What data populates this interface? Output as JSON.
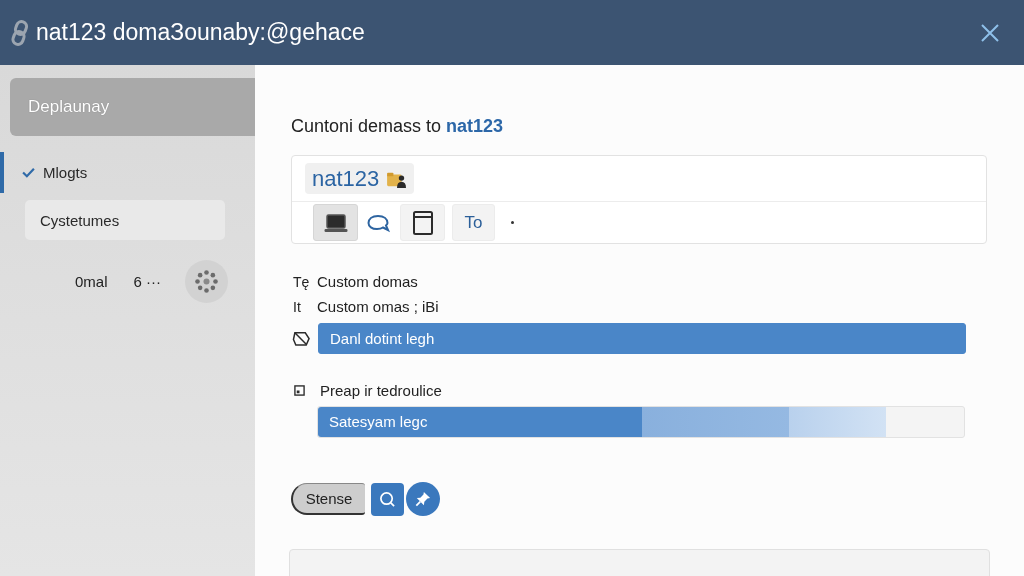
{
  "window": {
    "title": "nat123 domaЗounaby:@gehace"
  },
  "sidebar": {
    "header": "Deplaunay",
    "items": [
      {
        "kind": "check",
        "label": "Mlogts",
        "checked": true,
        "selected": true
      },
      {
        "kind": "plain",
        "label": "Cystetumes",
        "checked": false,
        "selected": false
      }
    ],
    "footer": {
      "label": "0mal",
      "count": "6 ···"
    }
  },
  "main": {
    "heading": "Cuntoni demass to **nat123**",
    "domain_card": {
      "chip": "nat123",
      "toolbar": [
        {
          "kind": "laptop",
          "selected": true
        },
        {
          "kind": "chat",
          "selected": false
        },
        {
          "kind": "window",
          "selected": false
        },
        {
          "kind": "text",
          "label": "To",
          "selected": false
        }
      ]
    },
    "options": [
      {
        "tag": "Tę",
        "label": "Custom domas"
      },
      {
        "tag": "It",
        "label": "Custom omas ; iBi"
      }
    ],
    "domain_field": {
      "value": "Danl dotint legh",
      "highlighted": true
    },
    "preview": {
      "label": "Preap ir tedroulice",
      "bar_label": "Satesyam legc",
      "level": 0.88
    },
    "actions": [
      {
        "kind": "text",
        "label": "Stense"
      },
      {
        "kind": "search"
      },
      {
        "kind": "pin"
      }
    ]
  }
}
